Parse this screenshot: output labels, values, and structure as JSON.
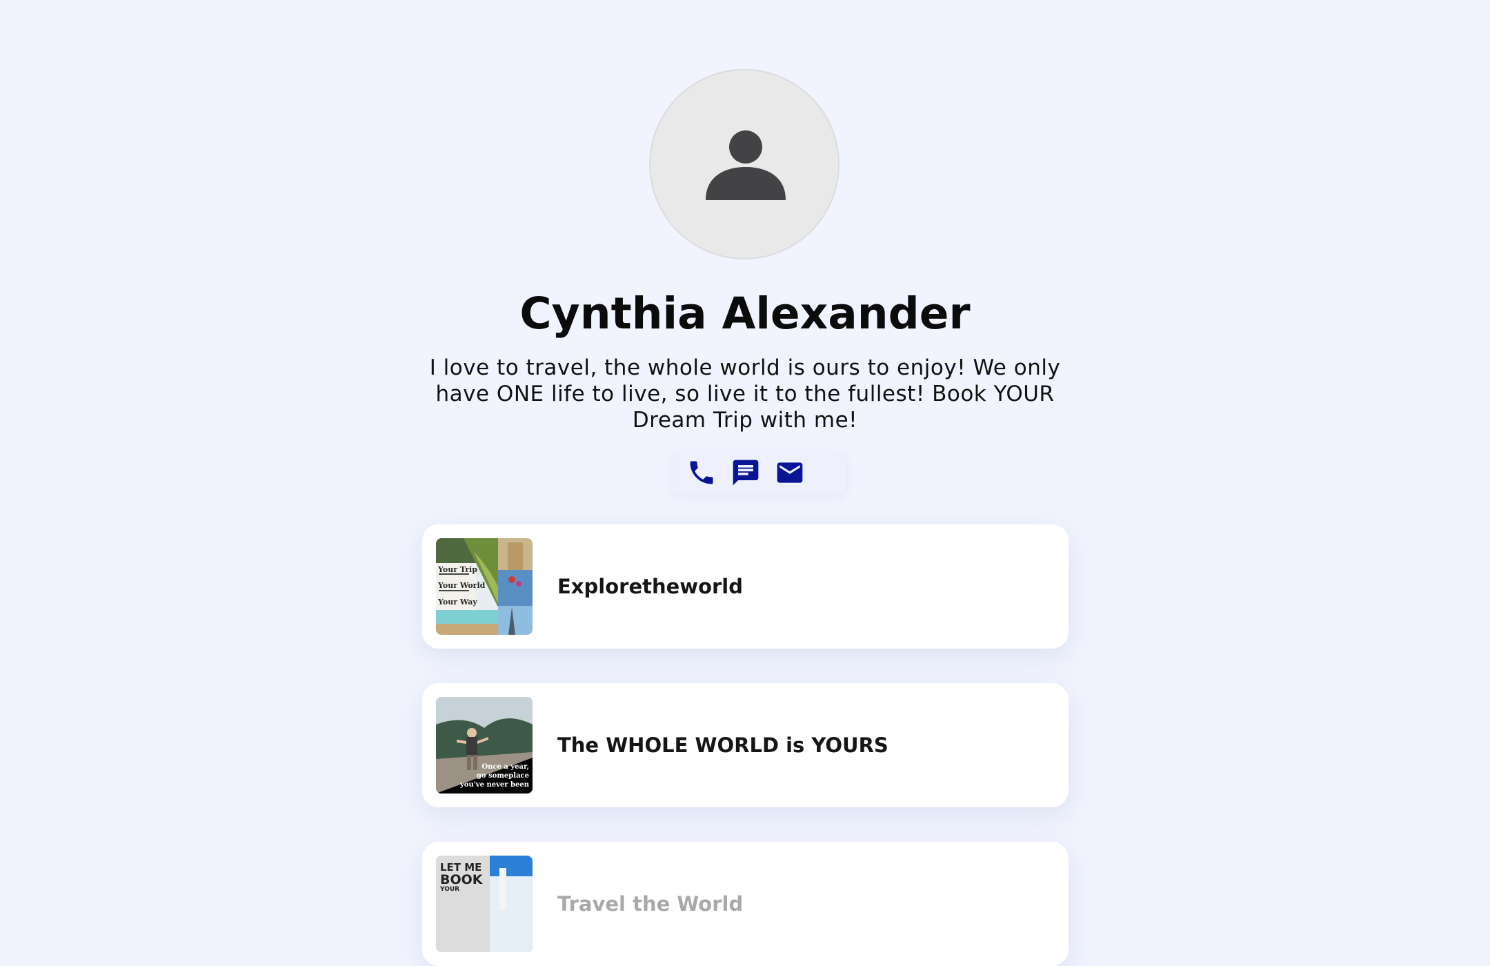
{
  "profile": {
    "name": "Cynthia Alexander",
    "bio": "I love to travel, the whole world is ours to enjoy! We only have ONE life to live, so live it to the fullest! Book YOUR Dream Trip with me!"
  },
  "contact": {
    "icons": [
      "phone-icon",
      "message-icon",
      "email-icon"
    ],
    "icon_color": "#0a1596"
  },
  "links": [
    {
      "label": "Exploretheworld",
      "thumb": {
        "lines": [
          "Your Trip",
          "Your World",
          "Your Way"
        ]
      }
    },
    {
      "label": "The WHOLE WORLD is YOURS",
      "thumb": {
        "lines": [
          "Once a year,",
          "go someplace",
          "you've never been"
        ]
      }
    },
    {
      "label": "Travel the World",
      "thumb": {
        "lines": [
          "LET ME",
          "BOOK",
          "YOUR"
        ]
      }
    }
  ],
  "colors": {
    "background": "#f1f4fe",
    "card": "#ffffff",
    "accent": "#0a1596"
  }
}
